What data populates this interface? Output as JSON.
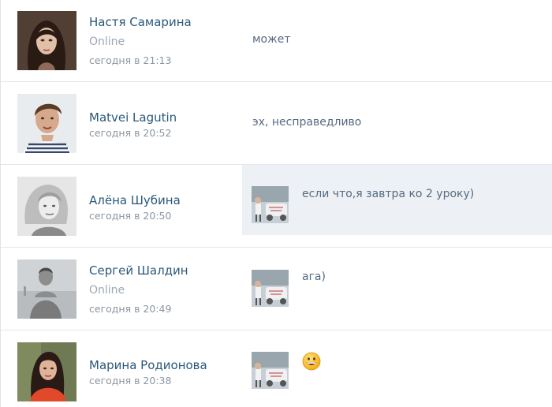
{
  "dialogs": [
    {
      "name": "Настя Самарина",
      "status": "Online",
      "time": "сегодня в 21:13",
      "message": "может"
    },
    {
      "name": "Matvei Lagutin",
      "time": "сегодня в 20:52",
      "message": "эх, несправедливо"
    },
    {
      "name": "Алёна Шубина",
      "time": "сегодня в 20:50",
      "message": "если что,я завтра ко 2 уроку)"
    },
    {
      "name": "Сергей Шалдин",
      "status": "Online",
      "time": "сегодня в 20:49",
      "message": "ага)"
    },
    {
      "name": "Марина Родионова",
      "time": "сегодня в 20:38",
      "emoji": "grinning-face-emoji"
    }
  ],
  "colors": {
    "name": "#2b587a",
    "status": "#9ea8b3",
    "time": "#8c96a0",
    "message": "#566a7f",
    "unread_bg": "#edf1f5",
    "divider": "#e4e7ea"
  }
}
